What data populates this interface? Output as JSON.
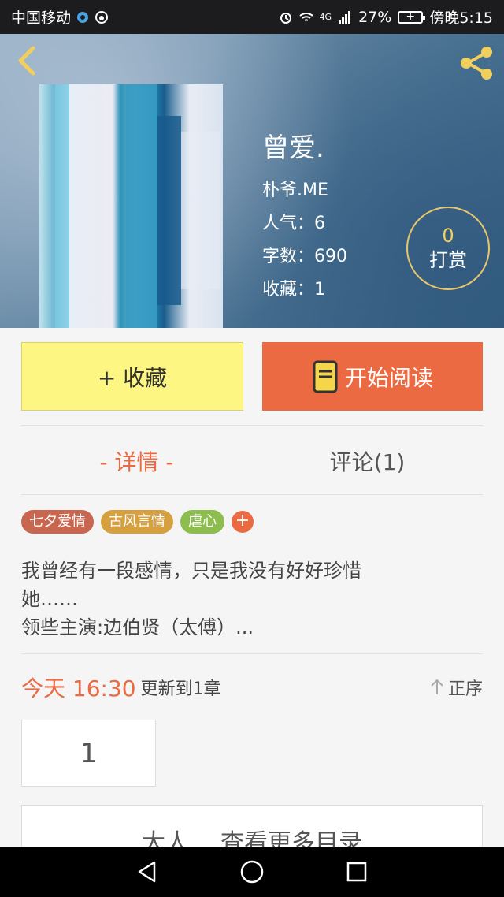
{
  "status_bar": {
    "carrier": "中国移动",
    "network": "4G",
    "battery_percent": "27%",
    "time": "傍晚5:15"
  },
  "header": {
    "back_icon": "chevron-left-icon",
    "share_icon": "share-icon",
    "accent_color": "#f2cf5c"
  },
  "book": {
    "title": "曾爱.",
    "author": "朴爷.ME",
    "popularity": "人气：6",
    "word_count": "字数：690",
    "favorites": "收藏：1"
  },
  "tip": {
    "count": "0",
    "label": "打赏"
  },
  "actions": {
    "collect_label": "+ 收藏",
    "read_label": "开始阅读",
    "collect_color": "#fdf683",
    "read_color": "#ec6a42"
  },
  "tabs": {
    "detail": "- 详情 -",
    "comment": "评论(1)"
  },
  "tags": [
    {
      "label": "七夕爱情",
      "color": "#c9664f"
    },
    {
      "label": "古风言情",
      "color": "#d6a040"
    },
    {
      "label": "虐心",
      "color": "#8dbd4f"
    }
  ],
  "tag_add": "+",
  "description": {
    "line1": "我曾经有一段感情，只是我没有好好珍惜",
    "line2": "她……",
    "line3": "领些主演:边伯贤（太傅）..."
  },
  "update": {
    "time": "今天 16:30",
    "text": "更新到1章",
    "sort_label": "正序"
  },
  "chapters": [
    "1"
  ],
  "more": {
    "left": "大人",
    "label": "查看更多目录"
  },
  "nav": {
    "back": "back-triangle-icon",
    "home": "home-circle-icon",
    "recent": "recent-square-icon"
  }
}
